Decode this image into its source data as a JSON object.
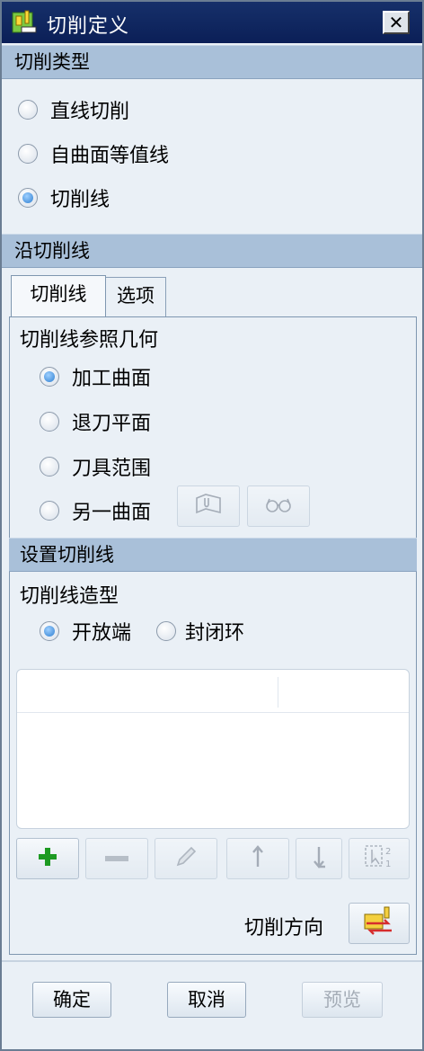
{
  "window": {
    "title": "切削定义",
    "close_label": "✕"
  },
  "cut_type": {
    "header": "切削类型",
    "options": [
      {
        "label": "直线切削",
        "checked": false
      },
      {
        "label": "自曲面等值线",
        "checked": false
      },
      {
        "label": "切削线",
        "checked": true
      }
    ]
  },
  "along_cut": {
    "header": "沿切削线",
    "tabs": [
      {
        "label": "切削线",
        "active": true
      },
      {
        "label": "选项",
        "active": false
      }
    ],
    "reference": {
      "label": "切削线参照几何",
      "options": [
        {
          "label": "加工曲面",
          "checked": true
        },
        {
          "label": "退刀平面",
          "checked": false
        },
        {
          "label": "刀具范围",
          "checked": false
        },
        {
          "label": "另一曲面",
          "checked": false
        }
      ]
    },
    "set_cut": {
      "header": "设置切削线",
      "shape_label": "切削线造型",
      "shapes": [
        {
          "label": "开放端",
          "checked": true
        },
        {
          "label": "封闭环",
          "checked": false
        }
      ]
    },
    "toolbar_icons": [
      "add-icon",
      "remove-icon",
      "edit-icon",
      "move-up-icon",
      "move-down-icon",
      "reorder-icon"
    ],
    "direction_label": "切削方向"
  },
  "buttons": {
    "ok": "确定",
    "cancel": "取消",
    "preview": "预览"
  }
}
